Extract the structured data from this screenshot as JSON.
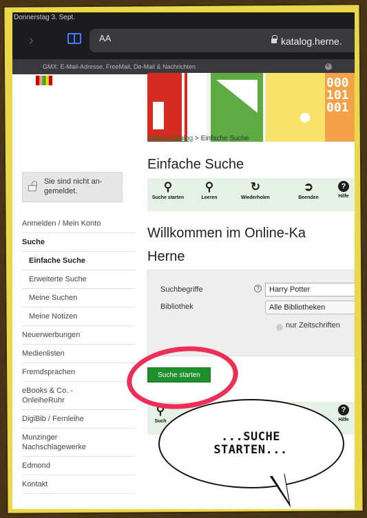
{
  "status_bar": {
    "time_date": "Donnerstag 3. Sept."
  },
  "browser": {
    "reader_label": "AA",
    "url": "katalog.herne.",
    "tab_title": "GMX: E-Mail-Adresse, FreeMail, De-Mail & Nachrichten"
  },
  "banner": {
    "binary_digits": "000\n101\n001"
  },
  "breadcrumb": {
    "link": "Online-Katalog",
    "separator": " > ",
    "current": "Einfache Suche"
  },
  "page": {
    "title": "Einfache Suche",
    "welcome_line1": "Willkommen im Online-Ka",
    "welcome_line2": "Herne"
  },
  "toolbar": {
    "search": "Suche starten",
    "clear": "Leeren",
    "repeat": "Wiederholen",
    "quit": "Beenden",
    "help": "Hilfe",
    "help_glyph": "?"
  },
  "toolbar_bottom": {
    "search_partial": "Such",
    "help": "Hilfe",
    "help_glyph": "?"
  },
  "form": {
    "search_label": "Suchbegriffe",
    "search_value": "Harry Potter",
    "library_label": "Bibliothek",
    "library_value": "Alle Bibliotheken",
    "journals_label": "nur Zeitschriften",
    "help_glyph": "?",
    "submit_label": "Suche starten"
  },
  "sidebar": {
    "login_status": "Sie sind nicht an-\ngemeldet.",
    "items": [
      {
        "label": "Anmelden / Mein Konto"
      },
      {
        "label": "Suche"
      },
      {
        "label": "Einfache Suche"
      },
      {
        "label": "Erweiterte Suche"
      },
      {
        "label": "Meine Suchen"
      },
      {
        "label": "Meine Notizen"
      },
      {
        "label": "Neuerwerbungen"
      },
      {
        "label": "Medienlisten"
      },
      {
        "label": "Fremdsprachen"
      },
      {
        "label": "eBooks & Co. -\nOnleiheRuhr"
      },
      {
        "label": "DigiBib / Fernleihe"
      },
      {
        "label": "Munzinger\nNachschlagewerke"
      },
      {
        "label": "Edmond"
      },
      {
        "label": "Kontakt"
      }
    ]
  },
  "annotation": {
    "bubble_text": "...SUCHE\nSTARTEN...",
    "highlight_color": "#ec2e58"
  },
  "colors": {
    "frame": "#e8d84a",
    "accent_green": "#1e8f2d",
    "toolbar_bg": "#e4f1e4"
  }
}
